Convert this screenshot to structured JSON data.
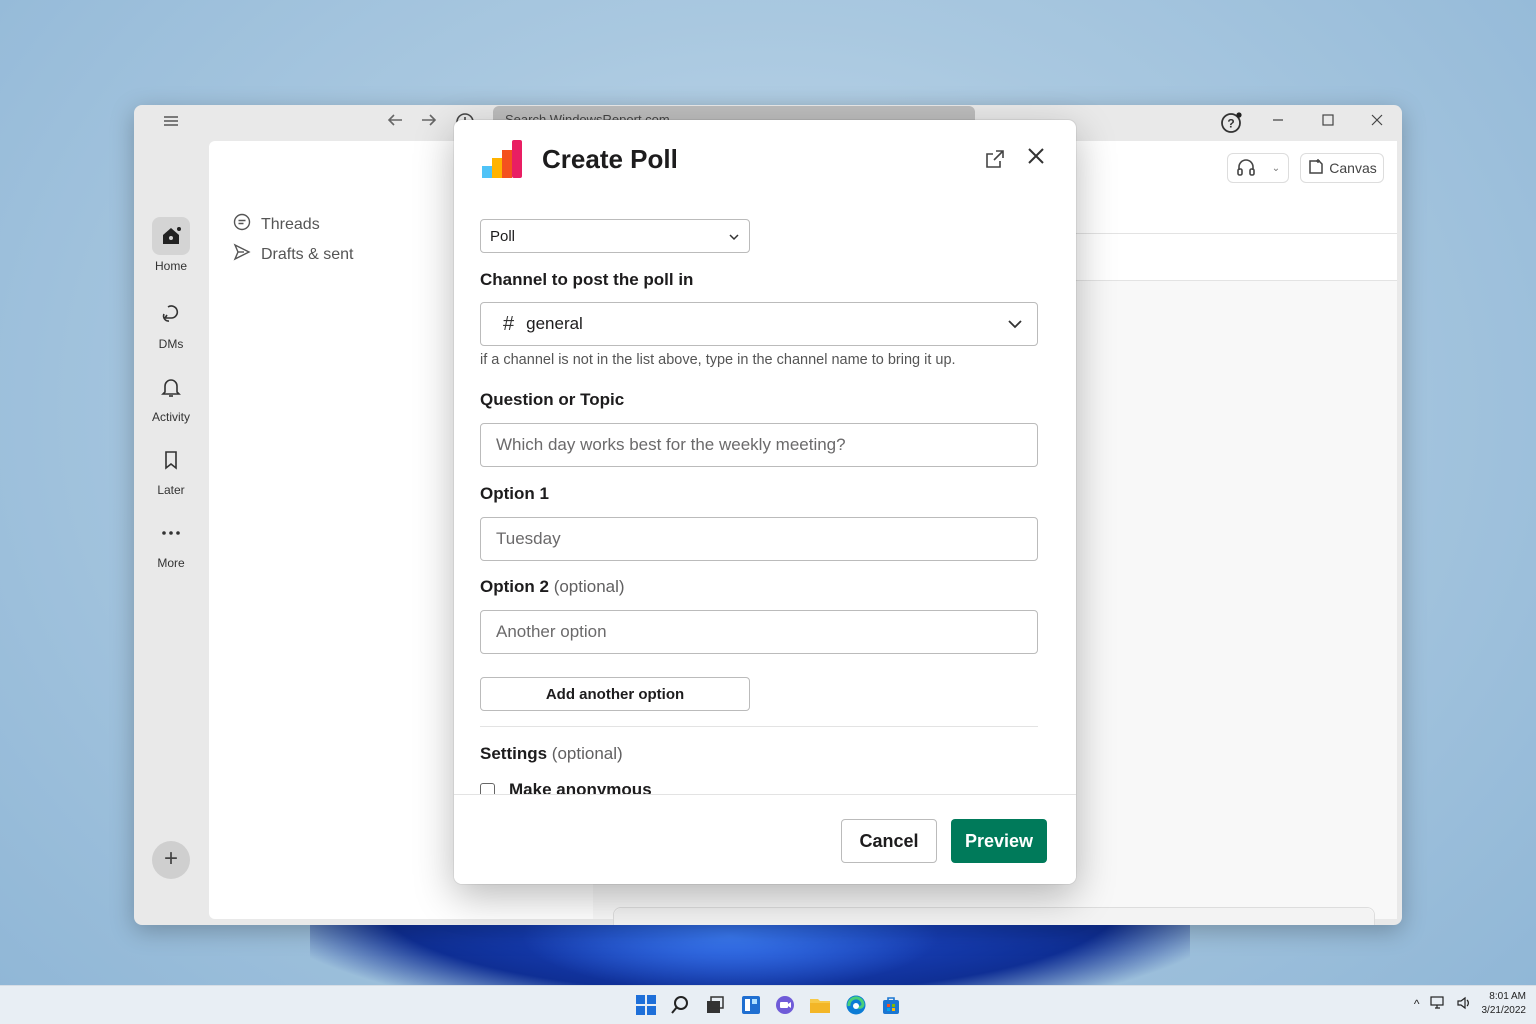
{
  "titlebar": {
    "search_placeholder": "Search WindowsReport.com"
  },
  "rail": {
    "items": [
      {
        "label": "Home"
      },
      {
        "label": "DMs"
      },
      {
        "label": "Activity"
      },
      {
        "label": "Later"
      },
      {
        "label": "More"
      }
    ]
  },
  "sidebar": {
    "items": [
      {
        "label": "Threads"
      },
      {
        "label": "Drafts & sent"
      }
    ]
  },
  "header": {
    "canvas_label": "Canvas"
  },
  "modal": {
    "title": "Create Poll",
    "type_select": "Poll",
    "channel_label": "Channel to post the poll in",
    "channel_value": "general",
    "channel_hint": "if a channel is not in the list above, type in the channel name to bring it up.",
    "question_label": "Question or Topic",
    "question_placeholder": "Which day works best for the weekly meeting?",
    "option1_label": "Option 1",
    "option1_placeholder": "Tuesday",
    "option2_label": "Option 2",
    "option2_suffix": "(optional)",
    "option2_placeholder": "Another option",
    "add_option_label": "Add another option",
    "settings_label": "Settings",
    "settings_suffix": "(optional)",
    "anonymous_label": "Make anonymous",
    "cancel_label": "Cancel",
    "preview_label": "Preview",
    "logo_colors": [
      "#4fc3f7",
      "#ffb300",
      "#f4511e",
      "#e91e63"
    ]
  },
  "taskbar": {
    "time": "8:01 AM",
    "date": "3/21/2022"
  },
  "colors": {
    "accent": "#007a5a"
  }
}
